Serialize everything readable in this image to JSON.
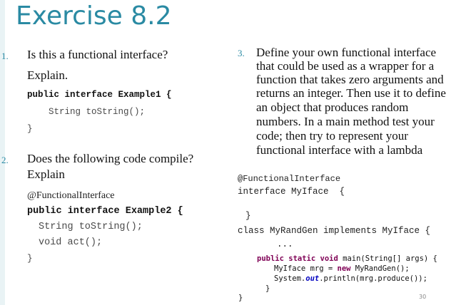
{
  "title": "Exercise 8.2",
  "q1": {
    "number": "1.",
    "text_line1": "Is this a functional interface?",
    "text_line2": "Explain.",
    "code_decl": "public interface Example1 {",
    "code_method": "String toString();",
    "code_close": "}"
  },
  "q2": {
    "number": "2.",
    "text_line1": "Does the following code compile?",
    "text_line2": "Explain",
    "annotation": "@FunctionalInterface",
    "code_decl": "public interface Example2 {",
    "code_method1": "String toString();",
    "code_method2": "void act();",
    "code_close": "}"
  },
  "q3": {
    "number": "3.",
    "lines": [
      "Define your own functional interface",
      "that could be used as a wrapper for a",
      "function that takes zero arguments and",
      "returns an integer. Then use it to define",
      "an object that produces random",
      "numbers. In a main method test your",
      "code; then try to represent your",
      "functional interface with a lambda"
    ],
    "code_annotation": "@FunctionalInterface",
    "code_iface": "interface MyIface  {",
    "code_iface_close": "}",
    "code_class": "class MyRandGen implements MyIface {",
    "code_ellipsis": "...",
    "main_kw": "public static void",
    "main_rest": " main(String[] args) {",
    "line_a_pre": "MyIface mrg = ",
    "line_a_kw": "new",
    "line_a_post": " MyRandGen();",
    "line_b_pre": "System.",
    "line_b_field": "out",
    "line_b_post": ".println(mrg.produce());",
    "main_close": "}",
    "class_close": "}"
  },
  "page_number": "30"
}
